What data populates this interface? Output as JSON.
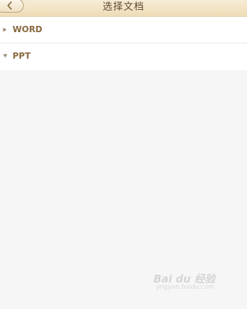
{
  "header": {
    "title": "选择文档",
    "back_icon": "chevron-left-icon"
  },
  "groups": [
    {
      "label": "WORD",
      "expanded": false,
      "icon": "caret-right-icon"
    },
    {
      "label": "PPT",
      "expanded": true,
      "icon": "caret-down-icon"
    }
  ],
  "watermark": {
    "text": "Bai du 经验",
    "sub": "jingyan.baidu.com"
  },
  "colors": {
    "header_bg": "#f2e3c5",
    "label": "#8a6a43",
    "page_bg": "#f6f6f6"
  }
}
